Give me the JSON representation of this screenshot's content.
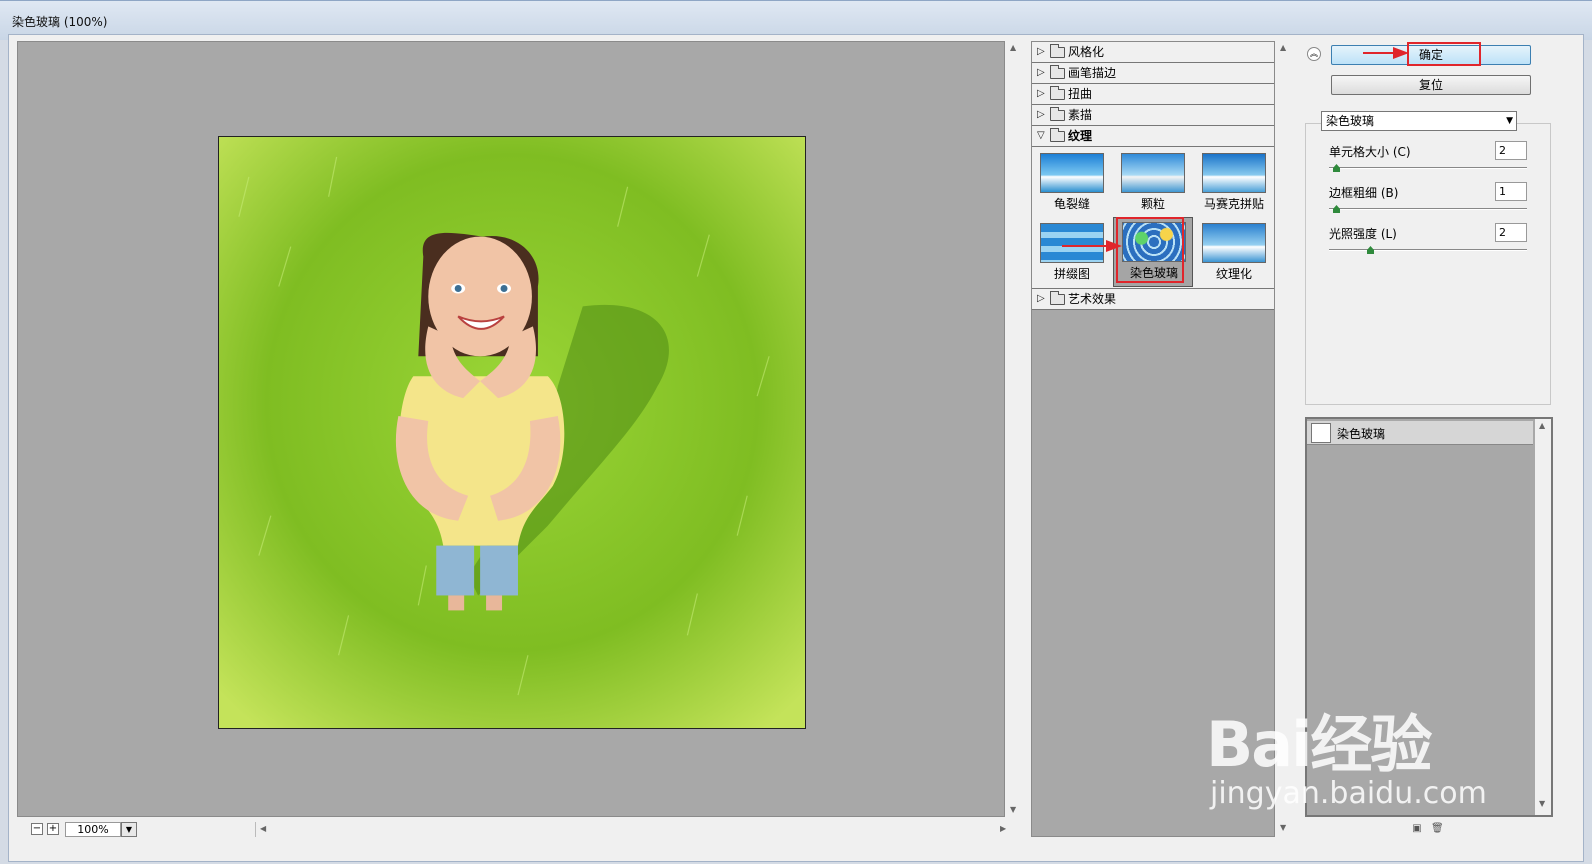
{
  "window": {
    "title": "染色玻璃 (100%)"
  },
  "preview": {
    "zoom": "100%"
  },
  "gallery": {
    "categories": [
      {
        "label": "风格化",
        "open": false
      },
      {
        "label": "画笔描边",
        "open": false
      },
      {
        "label": "扭曲",
        "open": false
      },
      {
        "label": "素描",
        "open": false
      },
      {
        "label": "纹理",
        "open": true
      },
      {
        "label": "艺术效果",
        "open": false
      }
    ],
    "texture_filters": [
      {
        "label": "龟裂缝"
      },
      {
        "label": "颗粒"
      },
      {
        "label": "马赛克拼贴"
      },
      {
        "label": "拼缀图"
      },
      {
        "label": "染色玻璃",
        "selected": true
      },
      {
        "label": "纹理化"
      }
    ]
  },
  "actions": {
    "ok": "确定",
    "reset": "复位"
  },
  "filter_select": {
    "value": "染色玻璃"
  },
  "params": [
    {
      "label": "单元格大小 (C)",
      "value": "2",
      "slider_fraction": 0.02
    },
    {
      "label": "边框粗细 (B)",
      "value": "1",
      "slider_fraction": 0.02
    },
    {
      "label": "光照强度 (L)",
      "value": "2",
      "slider_fraction": 0.2
    }
  ],
  "layers": {
    "items": [
      {
        "label": "染色玻璃"
      }
    ]
  },
  "watermark": {
    "brand": "Bai经验",
    "url": "jingyan.baidu.com"
  },
  "colors": {
    "highlight": "#e0252b",
    "grass": "#8dc82b",
    "panel_gray": "#a8a8a8"
  }
}
